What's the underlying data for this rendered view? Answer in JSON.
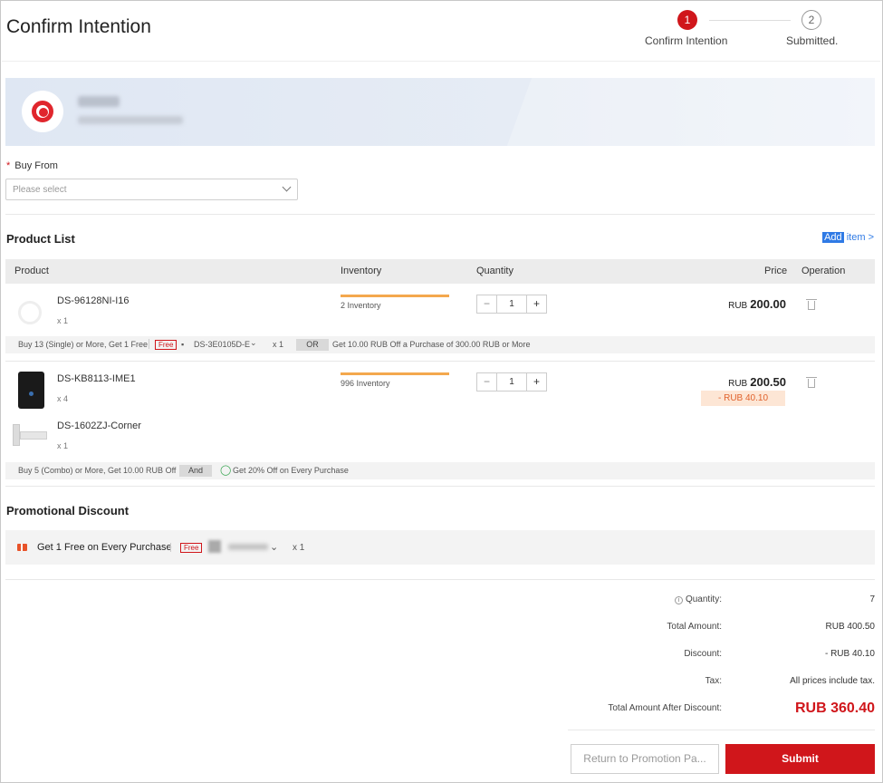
{
  "page": {
    "title": "Confirm Intention"
  },
  "steps": [
    {
      "number": "1",
      "label": "Confirm Intention",
      "active": true
    },
    {
      "number": "2",
      "label": "Submitted.",
      "active": false
    }
  ],
  "buy_from": {
    "label": "Buy From",
    "required_mark": "*",
    "placeholder": "Please select"
  },
  "product_list": {
    "title": "Product List",
    "add_item": {
      "highlight": "Add",
      "rest": " item >"
    },
    "columns": [
      "Product",
      "Inventory",
      "Quantity",
      "Price",
      "Operation"
    ],
    "items": [
      {
        "name": "DS-96128NI-I16",
        "qty": "x 1",
        "inventory": "2 Inventory",
        "quantity": "1",
        "price_currency": "RUB",
        "price": "200.00",
        "promo": {
          "text": "Buy 13 (Single) or More, Get 1 Free",
          "free_tag": "Free",
          "gift_model": "DS-3E0105D-E",
          "gift_qty": "x 1",
          "connector": "OR",
          "alt": "Get 10.00 RUB Off a Purchase of 300.00 RUB or More"
        }
      },
      {
        "name": "DS-KB8113-IME1",
        "qty": "x 4",
        "inventory": "996 Inventory",
        "quantity": "1",
        "price_currency": "RUB",
        "price": "200.50",
        "discount": "- RUB 40.10",
        "sub_item": {
          "name": "DS-1602ZJ-Corner",
          "qty": "x 1"
        },
        "promo": {
          "text": "Buy 5 (Combo) or More, Get 10.00 RUB Off",
          "connector": "And",
          "alt": "Get 20% Off on Every Purchase"
        }
      }
    ]
  },
  "promotional_discount": {
    "title": "Promotional Discount",
    "label": "Get 1 Free on Every Purchase",
    "free_tag": "Free",
    "qty": "x 1"
  },
  "summary": {
    "quantity_label": "Quantity:",
    "quantity": "7",
    "total_label": "Total Amount:",
    "total": "RUB 400.50",
    "discount_label": "Discount:",
    "discount": "- RUB 40.10",
    "tax_label": "Tax:",
    "tax": "All prices include tax.",
    "after_label": "Total Amount After Discount:",
    "after": "RUB 360.40"
  },
  "actions": {
    "return_label": "Return to Promotion Pa...",
    "submit_label": "Submit"
  },
  "colors": {
    "accent": "#d0161b",
    "inventory_bar": "#f4a84d",
    "link": "#2f7ae5"
  }
}
